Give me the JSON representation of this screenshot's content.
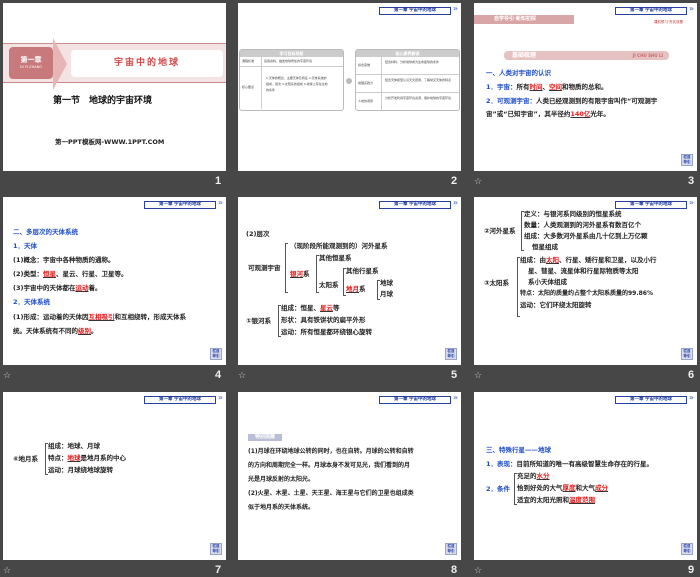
{
  "header_tag": "第一章 宇宙中的地球",
  "back_label": "栏目导引",
  "slides": [
    {
      "number": "1",
      "chapter": "第一章",
      "chapter_pinyin": "DI YI ZHANG",
      "chapter_title": "宇宙中的地球",
      "section_title": "第一节　地球的宇宙环境",
      "site": "第一PPT模板网-WWW.1PPT.COM"
    },
    {
      "number": "2",
      "left_title": "学习目标导航",
      "right_title": "核心素养解读",
      "rows_left": [
        {
          "k": "课程标准",
          "v": "运用资料，描述地球所处的宇宙环境"
        },
        {
          "k": "核心要点",
          "v": "1.天体的概念、主要天体及特征 2.天体系统的组成、层次 3.太阳系的组成 4.地球上存在生命的条件"
        }
      ],
      "rows_right": [
        {
          "k": "综合思维",
          "v": "结合材料，分析地球成为生命星球的条件"
        },
        {
          "k": "地理实践力",
          "v": "结合天体模型认识天文观测，了解常见天体的特点"
        },
        {
          "k": "人地协调观",
          "v": "分析开发利用宇宙环境资源，保护地球的宇宙环境"
        }
      ]
    },
    {
      "number": "3",
      "banner": "自学导引·新知初探",
      "banner_right": "课前预习·夯实双基",
      "section": "基础梳理",
      "section_pinyin": "JI CHU SHU LI",
      "h1": "一、人类对宇宙的认识",
      "l1a": "1．宇宙：",
      "l1b": "所有",
      "f1": "时间",
      "l1c": "、",
      "f2": "空间",
      "l1d": "和物质的总和。",
      "l2a": "2．可观测宇宙：",
      "l2b": "人类已经观测到的有限宇宙叫作“可观测宇",
      "l2c": "宙”或“已知宇宙”，其半径约",
      "f3": "140亿",
      "l2d": "光年。"
    },
    {
      "number": "4",
      "h": "二、多层次的天体系统",
      "s1": "1．天体",
      "p1": "(1)概念：宇宙中各种物质的通称。",
      "p2a": "(2)类型：",
      "f1": "恒星",
      "p2b": "、星云、行星、卫星等。",
      "p3a": "(3)宇宙中的天体都在",
      "f2": "运动",
      "p3b": "着。",
      "s2": "2．天体系统",
      "p4a": "(1)形成：运动着的天体因",
      "f3": "互相吸引",
      "p4b": "和互相绕转，形成天体系",
      "p5a": "统。天体系统有不同的",
      "f4": "级别",
      "p5b": "。"
    },
    {
      "number": "5",
      "title": "(2)层次",
      "root": "可观测宇宙",
      "b1": "（现阶段所能观测到的）河外星系",
      "f1": "银河",
      "sys": "系",
      "b2": "其他恒星系",
      "b3": "太阳系",
      "b4": "其他行星系",
      "f2": "地月",
      "b5": "地球",
      "b6": "月球",
      "g": "①银河系",
      "g1a": "组成：恒星、",
      "f3": "星云",
      "g1b": "等",
      "g2": "形状：具有铁饼状的扁平外形",
      "g3": "运动：所有恒星都环绕银心旋转"
    },
    {
      "number": "6",
      "e": "②河外星系",
      "e1": "定义：与银河系同级别的恒星系统",
      "e2": "数量：人类观测到的河外星系有数百亿个",
      "e3": "组成：大多数河外星系由几十亿到上万亿颗",
      "e4": "恒星组成",
      "s": "③太阳系",
      "s1a": "组成：由",
      "f1": "太阳",
      "s1b": "、行星、矮行星和卫星，以及小行",
      "s2": "星、彗星、流星体和行星际物质等太阳",
      "s3": "系小天体组成",
      "s4": "特点：太阳的质量约占整个太阳系质量的99.86%",
      "s5": "运动：它们环绕太阳旋转"
    },
    {
      "number": "7",
      "m": "④地月系",
      "m1": "组成：地球、月球",
      "m2a": "特点：",
      "f1": "地球",
      "m2b": "是地月系的中心",
      "m3": "运动：月球绕地球旋转"
    },
    {
      "number": "8",
      "tag": "特别提醒",
      "p1": "(1)月球在环绕地球公转的同时，也在自转。月球的公转和自转",
      "p2": "的方向和周期完全一样。月球本身不发可见光，我们看到的月",
      "p3": "光是月球反射的太阳光。",
      "p4": "(2)火星、木星、土星、天王星、海王星与它们的卫星也组成类",
      "p5": "似于地月系的天体系统。"
    },
    {
      "number": "9",
      "h": "三、特殊行星——地球",
      "l1a": "1．表现：",
      "l1b": "目前所知道的唯一有高级智慧生命存在的行星。",
      "l2": "2．条件",
      "c1a": "充足的",
      "f1": "水分",
      "c2a": "恰到好处的大气",
      "f2": "厚度",
      "c2b": "和大气",
      "f3": "成分",
      "c3a": "适宜的太阳光照和",
      "f4": "温度范围"
    }
  ]
}
